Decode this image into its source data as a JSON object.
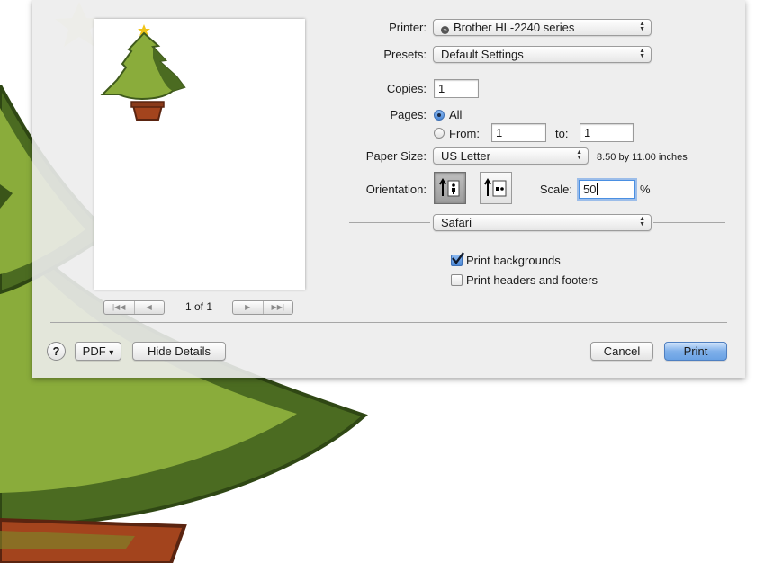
{
  "preview": {
    "page_counter": "1 of 1",
    "nav_first_glyph": "|◀◀",
    "nav_prev_glyph": "◀",
    "nav_next_glyph": "▶",
    "nav_last_glyph": "▶▶|"
  },
  "printer": {
    "label": "Printer:",
    "value": "Brother HL-2240 series"
  },
  "presets": {
    "label": "Presets:",
    "value": "Default Settings"
  },
  "copies": {
    "label": "Copies:",
    "value": "1"
  },
  "pages": {
    "label": "Pages:",
    "all_label": "All",
    "from_label": "From:",
    "from_value": "1",
    "to_label": "to:",
    "to_value": "1",
    "selected": "all"
  },
  "paper_size": {
    "label": "Paper Size:",
    "value": "US Letter",
    "dimensions": "8.50 by 11.00 inches"
  },
  "orientation": {
    "label": "Orientation:",
    "selected": "portrait"
  },
  "scale": {
    "label": "Scale:",
    "value": "50",
    "unit": "%"
  },
  "section_popup": {
    "value": "Safari"
  },
  "options": [
    {
      "label": "Print backgrounds",
      "checked": true
    },
    {
      "label": "Print headers and footers",
      "checked": false
    }
  ],
  "footer": {
    "help_label": "?",
    "pdf_label": "PDF",
    "pdf_arrow": "▾",
    "hide_details_label": "Hide Details",
    "cancel_label": "Cancel",
    "print_label": "Print"
  },
  "icons": {
    "printer_glyph": "⌁"
  },
  "colors": {
    "tree_light": "#8aac3b",
    "tree_dark": "#4b6b21",
    "pot": "#a3441d",
    "accent_blue": "#6aa2e4"
  }
}
